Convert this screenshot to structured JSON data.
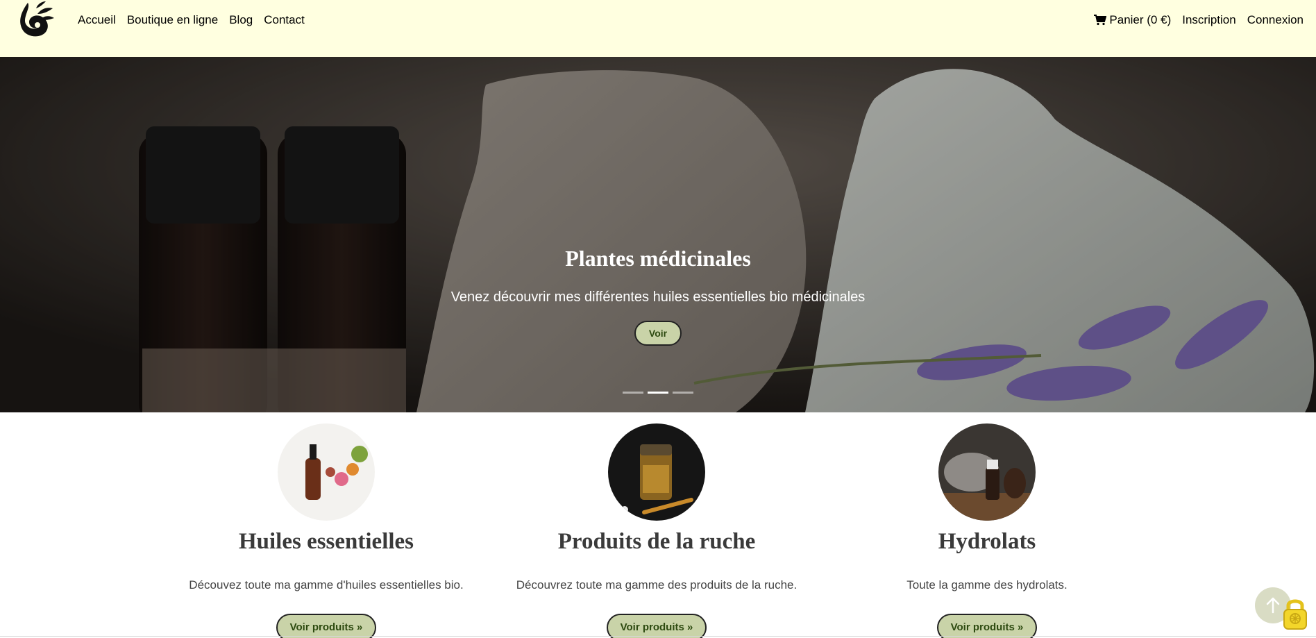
{
  "colors": {
    "navbar_bg": "#ffffe0",
    "button_bg": "#c9d3a8",
    "button_text": "#2d4a10"
  },
  "nav": {
    "logo_icon": "droplet-leaf-logo",
    "links": [
      "Accueil",
      "Boutique en ligne",
      "Blog",
      "Contact"
    ],
    "cart_label": "Panier (0 €)",
    "cart_icon": "shopping-cart-icon",
    "register_label": "Inscription",
    "login_label": "Connexion"
  },
  "hero": {
    "title": "Plantes médicinales",
    "text": "Venez découvrir mes différentes huiles essentielles bio médicinales",
    "button_label": "Voir",
    "slide_count": 3,
    "active_slide": 2
  },
  "features": [
    {
      "title": "Huiles essentielles",
      "text": "Découvez toute ma gamme d'huiles essentielles bio.",
      "button_label": "Voir produits »"
    },
    {
      "title": "Produits de la ruche",
      "text": "Découvrez toute ma gamme des produits de la ruche.",
      "button_label": "Voir produits »"
    },
    {
      "title": "Hydrolats",
      "text": "Toute la gamme des hydrolats.",
      "button_label": "Voir produits »"
    }
  ],
  "widgets": {
    "back_to_top_icon": "arrow-up-icon",
    "lock_icon": "padlock-icon"
  }
}
